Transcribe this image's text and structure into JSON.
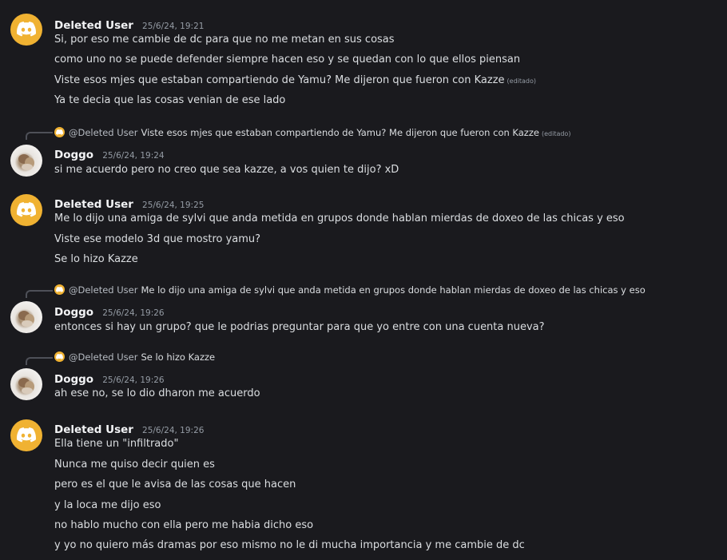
{
  "messages": [
    {
      "author": "Deleted User",
      "time": "25/6/24, 19:21",
      "lines": [
        "Si, por eso me cambie de dc para que no me metan en sus cosas",
        "como uno no se puede defender siempre hacen eso y se quedan con lo que ellos piensan",
        "Viste esos mjes que estaban compartiendo de Yamu? Me dijeron que fueron con Kazze",
        "Ya te decia que las cosas venian de ese lado"
      ],
      "edited_label": "(editado)"
    },
    {
      "reply_to": "@Deleted User",
      "reply_text": "Viste esos mjes que estaban compartiendo de Yamu? Me dijeron que fueron con Kazze",
      "reply_edited": "(editado)",
      "author": "Doggo",
      "time": "25/6/24, 19:24",
      "lines": [
        "si me acuerdo pero no creo que sea kazze, a vos quien te dijo? xD"
      ]
    },
    {
      "author": "Deleted User",
      "time": "25/6/24, 19:25",
      "lines": [
        "Me lo dijo una amiga de sylvi que anda metida en grupos donde hablan mierdas de doxeo de las chicas y eso",
        "Viste ese modelo 3d que mostro yamu?",
        "Se lo hizo Kazze"
      ]
    },
    {
      "reply_to": "@Deleted User",
      "reply_text": "Me lo dijo una amiga de sylvi que anda metida en grupos donde hablan mierdas de doxeo de las chicas y eso",
      "author": "Doggo",
      "time": "25/6/24, 19:26",
      "lines": [
        "entonces si hay un grupo? que le podrias preguntar para que yo entre con una cuenta nueva?"
      ]
    },
    {
      "reply_to": "@Deleted User",
      "reply_text": "Se lo hizo Kazze",
      "author": "Doggo",
      "time": "25/6/24, 19:26",
      "lines": [
        "ah ese no, se lo dio dharon me acuerdo"
      ]
    },
    {
      "author": "Deleted User",
      "time": "25/6/24, 19:26",
      "lines": [
        "Ella tiene un \"infiltrado\"",
        "Nunca me quiso decir quien es",
        "pero es el que le avisa de las cosas que hacen",
        "y la loca me dijo eso",
        "no hablo mucho con ella pero me habia dicho eso",
        "y yo no quiero más dramas por eso mismo no le di mucha importancia y me cambie de dc"
      ]
    }
  ],
  "colors": {
    "background": "#1a1a1e",
    "discord_avatar": "#f0b232",
    "username": "#f2f3f5",
    "muted": "#949ba4"
  },
  "icons": {
    "deleted_user_avatar": "discord-logo-icon",
    "doggo_avatar": "photo-avatar"
  }
}
